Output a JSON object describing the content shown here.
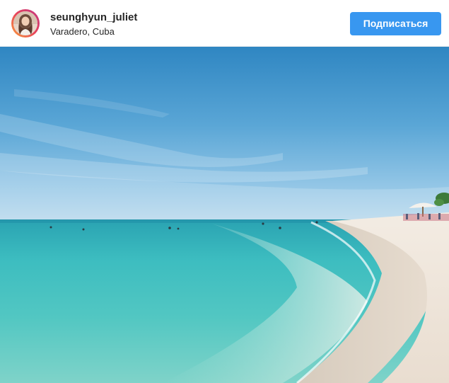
{
  "post": {
    "username": "seunghyun_juliet",
    "location": "Varadero, Cuba",
    "follow_label": "Подписаться",
    "avatar_icon": "profile-photo-avatar"
  },
  "colors": {
    "follow_button": "#3897f0",
    "username_text": "#262626"
  }
}
